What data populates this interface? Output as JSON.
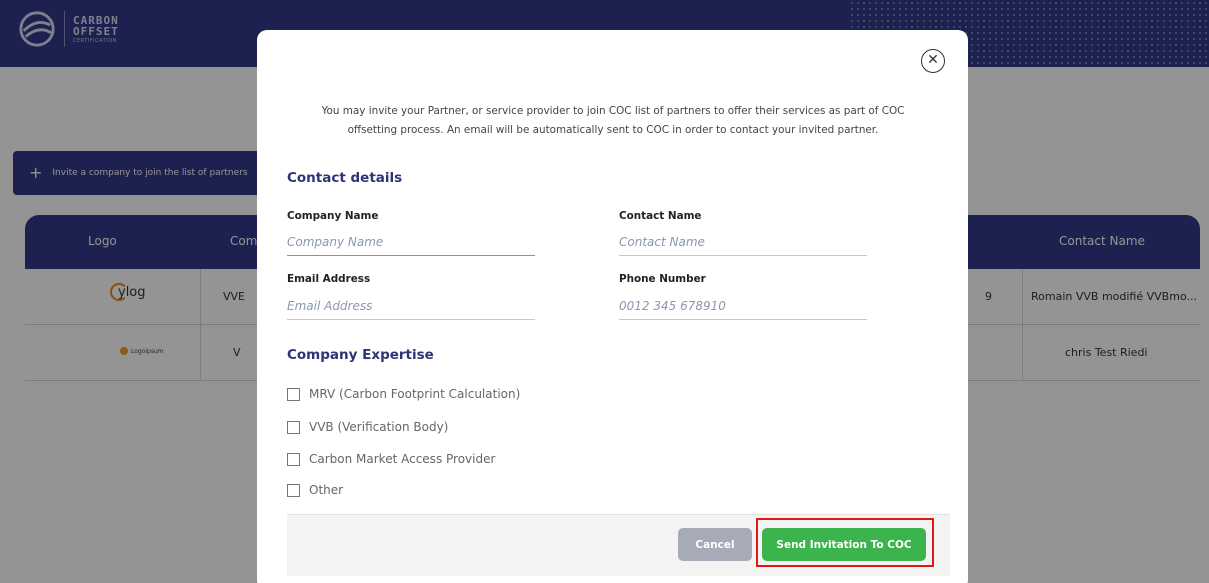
{
  "header": {
    "logo_line1": "CARBON",
    "logo_line2": "OFFSET",
    "logo_line3": "CERTIFICATION"
  },
  "page": {
    "invite_button_label": "Invite a company to join the list of partners",
    "table": {
      "columns": [
        "Logo",
        "Com",
        "Contact Name"
      ],
      "rows": [
        {
          "logo_text": "ylog",
          "company": "VVE",
          "num": "9",
          "contact": "Romain VVB modifié VVBmo..."
        },
        {
          "logo_text": "Logoipsum",
          "company": "V",
          "num": "",
          "contact": "chris Test Riedi"
        }
      ]
    }
  },
  "modal": {
    "intro_line1": "You may invite your Partner, or service provider to join COC list of partners to offer their services as part of COC",
    "intro_line2": "offsetting process. An email will be automatically sent to COC in order to contact your invited partner.",
    "contact_title": "Contact details",
    "fields": {
      "company_name": {
        "label": "Company Name",
        "placeholder": "Company Name"
      },
      "contact_name": {
        "label": "Contact Name",
        "placeholder": "Contact Name"
      },
      "email": {
        "label": "Email Address",
        "placeholder": "Email Address"
      },
      "phone": {
        "label": "Phone Number",
        "placeholder": "0012 345 678910"
      }
    },
    "expertise_title": "Company Expertise",
    "expertise_options": [
      "MRV (Carbon Footprint Calculation)",
      "VVB (Verification Body)",
      "Carbon Market Access Provider",
      "Other"
    ],
    "cancel_label": "Cancel",
    "send_label": "Send Invitation To COC"
  },
  "colors": {
    "brand": "#333a8a",
    "accent_green": "#3cb44d",
    "highlight": "#e01818"
  }
}
